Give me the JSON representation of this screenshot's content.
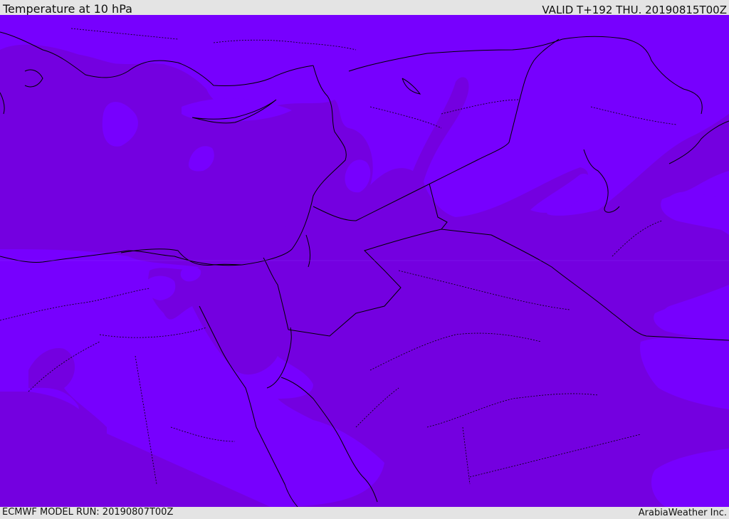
{
  "header": {
    "title": "Temperature at 10 hPa",
    "valid": "VALID T+192 THU. 20190815T00Z"
  },
  "footer": {
    "model_run": "ECMWF MODEL RUN: 20190807T00Z",
    "credit": "ArabiaWeather Inc."
  },
  "map": {
    "field_colors": {
      "lighter_band": "#7700fe",
      "darker_band": "#7400e0"
    },
    "coastline_color": "#000000",
    "border_color": "#000000"
  }
}
